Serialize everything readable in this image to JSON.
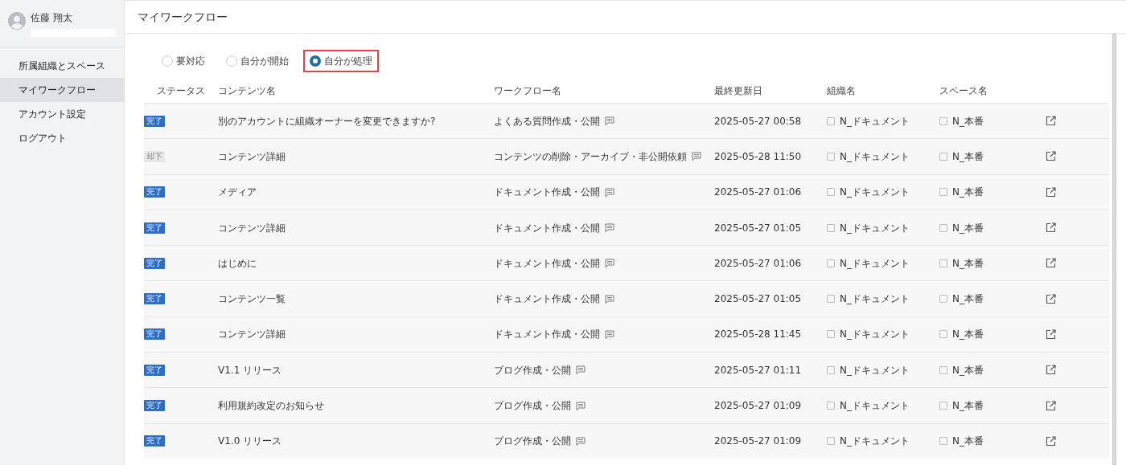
{
  "user": {
    "name": "佐藤 翔太"
  },
  "sidebar": {
    "items": [
      {
        "label": "所属組織とスペース",
        "selected": false
      },
      {
        "label": "マイワークフロー",
        "selected": true
      },
      {
        "label": "アカウント設定",
        "selected": false
      },
      {
        "label": "ログアウト",
        "selected": false
      }
    ]
  },
  "page_title": "マイワークフロー",
  "filters": [
    {
      "label": "要対応",
      "selected": false
    },
    {
      "label": "自分が開始",
      "selected": false
    },
    {
      "label": "自分が処理",
      "selected": true
    }
  ],
  "table": {
    "columns": [
      "ステータス",
      "コンテンツ名",
      "ワークフロー名",
      "最終更新日",
      "組織名",
      "スペース名"
    ],
    "rows": [
      {
        "status": {
          "label": "完了",
          "kind": "done"
        },
        "content": "別のアカウントに組織オーナーを変更できますか?",
        "workflow": "よくある質問作成・公開",
        "updated": "2025-05-27 00:58",
        "org": "N_ドキュメント",
        "space": "N_本番"
      },
      {
        "status": {
          "label": "却下",
          "kind": "rejected"
        },
        "content": "コンテンツ詳細",
        "workflow": "コンテンツの削除・アーカイブ・非公開依頼",
        "updated": "2025-05-28 11:50",
        "org": "N_ドキュメント",
        "space": "N_本番"
      },
      {
        "status": {
          "label": "完了",
          "kind": "done"
        },
        "content": "メディア",
        "workflow": "ドキュメント作成・公開",
        "updated": "2025-05-27 01:06",
        "org": "N_ドキュメント",
        "space": "N_本番"
      },
      {
        "status": {
          "label": "完了",
          "kind": "done"
        },
        "content": "コンテンツ詳細",
        "workflow": "ドキュメント作成・公開",
        "updated": "2025-05-27 01:05",
        "org": "N_ドキュメント",
        "space": "N_本番"
      },
      {
        "status": {
          "label": "完了",
          "kind": "done"
        },
        "content": "はじめに",
        "workflow": "ドキュメント作成・公開",
        "updated": "2025-05-27 01:06",
        "org": "N_ドキュメント",
        "space": "N_本番"
      },
      {
        "status": {
          "label": "完了",
          "kind": "done"
        },
        "content": "コンテンツ一覧",
        "workflow": "ドキュメント作成・公開",
        "updated": "2025-05-27 01:05",
        "org": "N_ドキュメント",
        "space": "N_本番"
      },
      {
        "status": {
          "label": "完了",
          "kind": "done"
        },
        "content": "コンテンツ詳細",
        "workflow": "ドキュメント作成・公開",
        "updated": "2025-05-28 11:45",
        "org": "N_ドキュメント",
        "space": "N_本番"
      },
      {
        "status": {
          "label": "完了",
          "kind": "done"
        },
        "content": "V1.1 リリース",
        "workflow": "ブログ作成・公開",
        "updated": "2025-05-27 01:11",
        "org": "N_ドキュメント",
        "space": "N_本番"
      },
      {
        "status": {
          "label": "完了",
          "kind": "done"
        },
        "content": "利用規約改定のお知らせ",
        "workflow": "ブログ作成・公開",
        "updated": "2025-05-27 01:09",
        "org": "N_ドキュメント",
        "space": "N_本番"
      },
      {
        "status": {
          "label": "完了",
          "kind": "done"
        },
        "content": "V1.0 リリース",
        "workflow": "ブログ作成・公開",
        "updated": "2025-05-27 01:09",
        "org": "N_ドキュメント",
        "space": "N_本番"
      }
    ]
  }
}
